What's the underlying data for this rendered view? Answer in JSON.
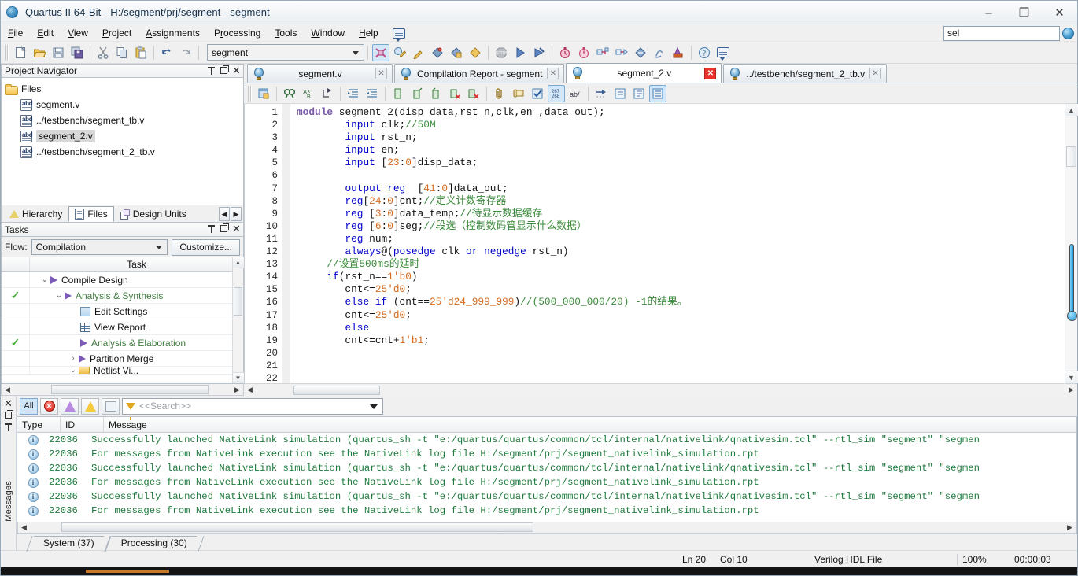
{
  "window": {
    "title": "Quartus II 64-Bit - H:/segment/prj/segment - segment",
    "icon": "quartus-logo-icon",
    "minimize": "–",
    "maximize": "❐",
    "close": "✕"
  },
  "menubar": {
    "items": [
      "File",
      "Edit",
      "View",
      "Project",
      "Assignments",
      "Processing",
      "Tools",
      "Window",
      "Help"
    ],
    "help_balloon_icon": "message-balloon-icon",
    "search": {
      "value": "sel",
      "placeholder": ""
    },
    "search_globe_icon": "globe-icon"
  },
  "toolbar": {
    "project_combo": "segment",
    "icons": [
      "new-file-icon",
      "open-file-icon",
      "save-icon",
      "save-all-icon",
      "cut-icon",
      "copy-icon",
      "paste-icon",
      "undo-icon",
      "redo-icon",
      "compile-stop-icon",
      "assignment-editor-icon",
      "pin-planner-icon",
      "start-compilation-icon",
      "start-analysis-icon",
      "programmer-icon",
      "stop-icon",
      "play-icon",
      "fast-forward-icon",
      "timing-analyzer-icon",
      "timequest-icon",
      "rtl-viewer-icon",
      "tech-map-viewer-icon",
      "chip-planner-icon",
      "signaltap-icon",
      "megawizard-icon",
      "help-icon",
      "message-icon"
    ]
  },
  "project_navigator": {
    "title": "Project Navigator",
    "root": {
      "label": "Files",
      "icon": "folder-icon"
    },
    "files": [
      {
        "label": "segment.v",
        "icon": "verilog-file-icon",
        "selected": false
      },
      {
        "label": "../testbench/segment_tb.v",
        "icon": "verilog-file-icon",
        "selected": false
      },
      {
        "label": "segment_2.v",
        "icon": "verilog-file-icon",
        "selected": true
      },
      {
        "label": "../testbench/segment_2_tb.v",
        "icon": "verilog-file-icon",
        "selected": false
      }
    ],
    "tabs": [
      {
        "label": "Hierarchy",
        "icon": "hierarchy-icon",
        "active": false
      },
      {
        "label": "Files",
        "icon": "files-icon",
        "active": true
      },
      {
        "label": "Design Units",
        "icon": "design-units-icon",
        "active": false
      }
    ],
    "nav_prev": "◀",
    "nav_next": "▶"
  },
  "tasks": {
    "title": "Tasks",
    "flow_label": "Flow:",
    "flow_value": "Compilation",
    "customize_label": "Customize...",
    "column_header": "Task",
    "rows": [
      {
        "check": false,
        "indent": 1,
        "twisty": "⌄",
        "arrow": true,
        "label": "Compile Design",
        "green": false,
        "icon": ""
      },
      {
        "check": true,
        "indent": 2,
        "twisty": "⌄",
        "arrow": true,
        "label": "Analysis & Synthesis",
        "green": true,
        "icon": ""
      },
      {
        "check": false,
        "indent": 3,
        "twisty": "",
        "arrow": false,
        "label": "Edit Settings",
        "green": false,
        "icon": "edit-settings-icon"
      },
      {
        "check": false,
        "indent": 3,
        "twisty": "",
        "arrow": false,
        "label": "View Report",
        "green": false,
        "icon": "view-report-icon"
      },
      {
        "check": true,
        "indent": 3,
        "twisty": "",
        "arrow": true,
        "label": "Analysis & Elaboration",
        "green": true,
        "icon": ""
      },
      {
        "check": false,
        "indent": 3,
        "twisty": "›",
        "arrow": true,
        "label": "Partition Merge",
        "green": false,
        "icon": ""
      },
      {
        "check": false,
        "indent": 3,
        "twisty": "⌄",
        "arrow": false,
        "label": "Netlist Vi...",
        "green": false,
        "icon": "folder-small-icon"
      }
    ]
  },
  "editor": {
    "tabs": [
      {
        "label": "segment.v",
        "icon": "verilog-tab-icon",
        "active": false,
        "close_red": false
      },
      {
        "label": "Compilation Report - segment",
        "icon": "report-tab-icon",
        "active": false,
        "close_red": false
      },
      {
        "label": "segment_2.v",
        "icon": "verilog-tab-icon",
        "active": true,
        "close_red": true
      },
      {
        "label": "../testbench/segment_2_tb.v",
        "icon": "verilog-tab-icon",
        "active": false,
        "close_red": false
      }
    ],
    "toolbar_icons": [
      "insert-template-icon",
      "find-icon",
      "find-replace-icon",
      "goto-icon",
      "increase-indent-icon",
      "decrease-indent-icon",
      "comment-icon",
      "uncomment-icon",
      "bookmark-icon",
      "clear-bookmark-icon",
      "clear-all-bookmarks-icon",
      "attach-icon",
      "scroll-icon",
      "check-icon",
      "line-numbers-icon",
      "wrap-text-icon",
      "goto-line-icon",
      "collapse-icon",
      "expand-icon",
      "show-all-icon"
    ],
    "line_numbers": [
      1,
      2,
      3,
      4,
      5,
      6,
      7,
      8,
      9,
      10,
      11,
      12,
      13,
      14,
      15,
      16,
      17,
      18,
      19,
      20,
      21,
      22
    ],
    "code": [
      [
        [
          "mod",
          "module "
        ],
        [
          "plain",
          "segment_2(disp_data,rst_n,clk,en ,data_out);"
        ]
      ],
      [
        [
          "plain",
          "        "
        ],
        [
          "kw",
          "input"
        ],
        [
          "plain",
          " clk;"
        ],
        [
          "cmt",
          "//50M"
        ]
      ],
      [
        [
          "plain",
          "        "
        ],
        [
          "kw",
          "input"
        ],
        [
          "plain",
          " rst_n;"
        ]
      ],
      [
        [
          "plain",
          "        "
        ],
        [
          "kw",
          "input"
        ],
        [
          "plain",
          " en;"
        ]
      ],
      [
        [
          "plain",
          "        "
        ],
        [
          "kw",
          "input"
        ],
        [
          "plain",
          " ["
        ],
        [
          "num",
          "23"
        ],
        [
          "plain",
          ":"
        ],
        [
          "num",
          "0"
        ],
        [
          "plain",
          "]disp_data;"
        ]
      ],
      [],
      [
        [
          "plain",
          "        "
        ],
        [
          "kw",
          "output reg"
        ],
        [
          "plain",
          "  ["
        ],
        [
          "num",
          "41"
        ],
        [
          "plain",
          ":"
        ],
        [
          "num",
          "0"
        ],
        [
          "plain",
          "]data_out;"
        ]
      ],
      [
        [
          "plain",
          "        "
        ],
        [
          "kw",
          "reg"
        ],
        [
          "plain",
          "["
        ],
        [
          "num",
          "24"
        ],
        [
          "plain",
          ":"
        ],
        [
          "num",
          "0"
        ],
        [
          "plain",
          "]cnt;"
        ],
        [
          "cmt",
          "//定义计数寄存器"
        ]
      ],
      [
        [
          "plain",
          "        "
        ],
        [
          "kw",
          "reg"
        ],
        [
          "plain",
          " ["
        ],
        [
          "num",
          "3"
        ],
        [
          "plain",
          ":"
        ],
        [
          "num",
          "0"
        ],
        [
          "plain",
          "]data_temp;"
        ],
        [
          "cmt",
          "//待显示数据缓存"
        ]
      ],
      [
        [
          "plain",
          "        "
        ],
        [
          "kw",
          "reg"
        ],
        [
          "plain",
          " ["
        ],
        [
          "num",
          "6"
        ],
        [
          "plain",
          ":"
        ],
        [
          "num",
          "0"
        ],
        [
          "plain",
          "]seg;"
        ],
        [
          "cmt",
          "//段选（控制数码管显示什么数据）"
        ]
      ],
      [
        [
          "plain",
          "        "
        ],
        [
          "kw",
          "reg"
        ],
        [
          "plain",
          " num;"
        ]
      ],
      [
        [
          "plain",
          "        "
        ],
        [
          "kw",
          "always"
        ],
        [
          "plain",
          "@("
        ],
        [
          "kw",
          "posedge"
        ],
        [
          "plain",
          " clk "
        ],
        [
          "kw",
          "or"
        ],
        [
          "plain",
          " "
        ],
        [
          "kw",
          "negedge"
        ],
        [
          "plain",
          " rst_n)"
        ]
      ],
      [
        [
          "plain",
          "     "
        ],
        [
          "cmt",
          "//设置500ms的延时"
        ]
      ],
      [
        [
          "plain",
          "     "
        ],
        [
          "kw",
          "if"
        ],
        [
          "plain",
          "(rst_n=="
        ],
        [
          "num",
          "1'b0"
        ],
        [
          "plain",
          ")"
        ]
      ],
      [
        [
          "plain",
          "        cnt<="
        ],
        [
          "num",
          "25'd0"
        ],
        [
          "plain",
          ";"
        ]
      ],
      [
        [
          "plain",
          "        "
        ],
        [
          "kw",
          "else if"
        ],
        [
          "plain",
          " (cnt=="
        ],
        [
          "num",
          "25'd24_999_999"
        ],
        [
          "plain",
          ")"
        ],
        [
          "cmt",
          "//(500_000_000/20) -1的结果。"
        ]
      ],
      [
        [
          "plain",
          "        cnt<="
        ],
        [
          "num",
          "25'd0"
        ],
        [
          "plain",
          ";"
        ]
      ],
      [
        [
          "plain",
          "        "
        ],
        [
          "kw",
          "else"
        ]
      ],
      [
        [
          "plain",
          "        cnt<=cnt+"
        ],
        [
          "num",
          "1'b1"
        ],
        [
          "plain",
          ";"
        ]
      ],
      [],
      [],
      []
    ]
  },
  "messages": {
    "side_label": "Messages",
    "side_icons": [
      "close-icon",
      "restore-icon",
      "pin-icon"
    ],
    "filter_buttons": [
      {
        "label": "All",
        "name": "filter-all-button",
        "active": true
      },
      {
        "label": "",
        "name": "filter-error-button",
        "icon": "error-icon",
        "active": false
      },
      {
        "label": "",
        "name": "filter-critical-warning-button",
        "icon": "critical-warning-icon",
        "active": false
      },
      {
        "label": "",
        "name": "filter-warning-button",
        "icon": "warning-icon",
        "active": false
      },
      {
        "label": "",
        "name": "filter-info-button",
        "icon": "info-suppress-icon",
        "active": false
      }
    ],
    "search_placeholder": "<<Search>>",
    "columns": [
      "Type",
      "ID",
      "Message"
    ],
    "rows": [
      {
        "icon": "info-icon",
        "id": "22036",
        "text": "Successfully launched NativeLink simulation (quartus_sh -t \"e:/quartus/quartus/common/tcl/internal/nativelink/qnativesim.tcl\" --rtl_sim \"segment\" \"segmen"
      },
      {
        "icon": "info-icon",
        "id": "22036",
        "text": "For messages from NativeLink execution see the NativeLink log file H:/segment/prj/segment_nativelink_simulation.rpt"
      },
      {
        "icon": "info-icon",
        "id": "22036",
        "text": "Successfully launched NativeLink simulation (quartus_sh -t \"e:/quartus/quartus/common/tcl/internal/nativelink/qnativesim.tcl\" --rtl_sim \"segment\" \"segmen"
      },
      {
        "icon": "info-icon",
        "id": "22036",
        "text": "For messages from NativeLink execution see the NativeLink log file H:/segment/prj/segment_nativelink_simulation.rpt"
      },
      {
        "icon": "info-icon",
        "id": "22036",
        "text": "Successfully launched NativeLink simulation (quartus_sh -t \"e:/quartus/quartus/common/tcl/internal/nativelink/qnativesim.tcl\" --rtl_sim \"segment\" \"segmen"
      },
      {
        "icon": "info-icon",
        "id": "22036",
        "text": "For messages from NativeLink execution see the NativeLink log file H:/segment/prj/segment_nativelink_simulation.rpt"
      }
    ],
    "tabs": [
      {
        "label": "System (37)",
        "active": true
      },
      {
        "label": "Processing (30)",
        "active": false
      }
    ]
  },
  "statusbar": {
    "line": "Ln 20",
    "col": "Col 10",
    "filetype": "Verilog HDL File",
    "zoom": "100%",
    "elapsed": "00:00:03"
  },
  "colors": {
    "keyword": "#0000c8",
    "number": "#d46a1e",
    "comment": "#3a8a3a",
    "module": "#7b5ba8",
    "accent": "#cfe5f7",
    "error_red": "#e8332a",
    "check_green": "#4aaa3c"
  }
}
